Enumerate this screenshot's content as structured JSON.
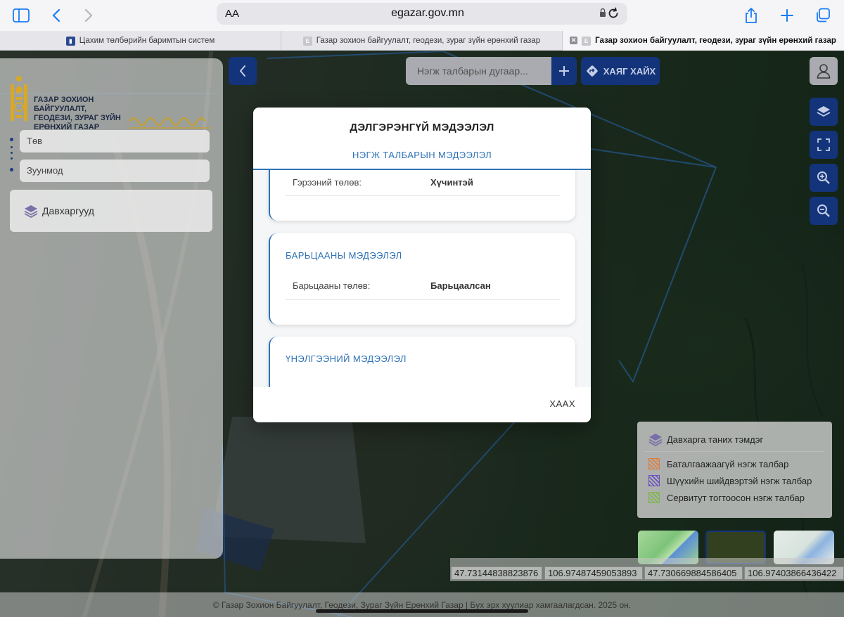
{
  "browser": {
    "url_aa": "AA",
    "url": "egazar.gov.mn",
    "tabs": [
      {
        "title": "Цахим төлбөрийн баримтын систем",
        "favicon_color": "#2b4a93"
      },
      {
        "title": "Газар зохион байгуулалт, геодези, зураг зүйн ерөнхий газар",
        "favicon_color": "#c7c7cc"
      },
      {
        "title": "Газар зохион байгуулалт, геодези, зураг зүйн ерөнхий газар",
        "favicon_color": "#c7c7cc"
      }
    ],
    "favicon_letter": "E"
  },
  "sidebar": {
    "logo_text": "Газар зохион байгуулалт, геодези, зураг зүйн ерөнхий газар",
    "province": "Төв",
    "district": "Зуунмод",
    "layers_label": "Давхаргууд"
  },
  "map_controls": {
    "search_placeholder": "Нэгж талбарын дугаар...",
    "find_address_label": "ХАЯГ ХАЙХ"
  },
  "modal": {
    "title": "ДЭЛГЭРЭНГҮЙ МЭДЭЭЛЭЛ",
    "tab": "НЭГЖ ТАЛБАРЫН МЭДЭЭЛЭЛ",
    "sections": [
      {
        "label": "Гэрээний төлөв:",
        "value": "Хүчинтэй"
      },
      {
        "heading": "БАРЬЦААНЫ МЭДЭЭЛЭЛ",
        "label": "Барьцааны төлөв:",
        "value": "Барьцаалсан"
      },
      {
        "heading": "ҮНЭЛГЭЭНИЙ МЭДЭЭЛЭЛ"
      }
    ],
    "close_label": "ХААХ"
  },
  "legend": {
    "title": "Давхарга таних тэмдэг",
    "items": [
      {
        "label": "Баталгаажаагүй нэгж талбар",
        "color": "#e07b39"
      },
      {
        "label": "Шүүхийн шийдвэртэй нэгж талбар",
        "color": "#6a4fc2"
      },
      {
        "label": "Сервитут тогтоосон нэгж талбар",
        "color": "#7ab648"
      }
    ]
  },
  "coordinates": [
    "47.73144838823876",
    "106.97487459053893",
    "47.730669884586405",
    "106.97403866436422"
  ],
  "footer": "© Газар Зохион Байгуулалт, Геодези, Зураг Зүйн Ерөнхий Газар | Бүх эрх хуулиар хамгаалагдсан. 2025 он."
}
